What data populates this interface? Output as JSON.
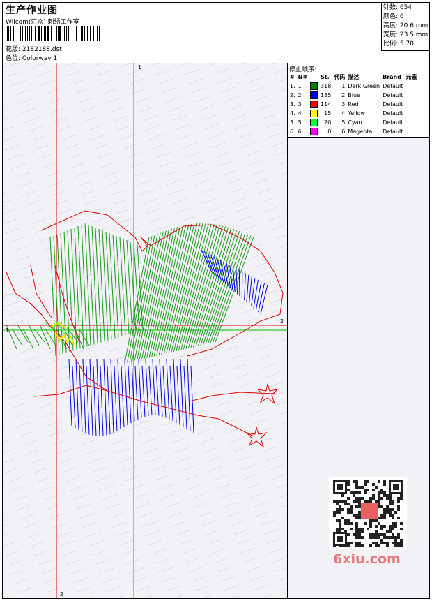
{
  "header": {
    "title": "生产作业图",
    "company": "Wilcom(汇众) 刺绣工作室",
    "design_label": "花版:",
    "design_value": "2182188.dst",
    "colorway_label": "色位:",
    "colorway_value": "Colorway 1"
  },
  "stats": {
    "stitches": "针数: 654",
    "colors": "颜色: 6",
    "height": "高度: 20.6 mm",
    "width": "宽度: 23.5 mm",
    "scale": "比例: 5.70"
  },
  "stop_sequence": {
    "title": "停止顺序:",
    "headers": [
      "#",
      "N#",
      "St.",
      "代码",
      "描述",
      "Brand",
      "元素"
    ],
    "rows": [
      {
        "idx": "1.",
        "n": "1",
        "color": "#008000",
        "st": "318",
        "code": "1",
        "desc": "Dark Green",
        "brand": "Default"
      },
      {
        "idx": "2.",
        "n": "2",
        "color": "#0000ff",
        "st": "185",
        "code": "2",
        "desc": "Blue",
        "brand": "Default"
      },
      {
        "idx": "3.",
        "n": "3",
        "color": "#ff0000",
        "st": "114",
        "code": "3",
        "desc": "Red",
        "brand": "Default"
      },
      {
        "idx": "4.",
        "n": "4",
        "color": "#ffff00",
        "st": "15",
        "code": "4",
        "desc": "Yellow",
        "brand": "Default"
      },
      {
        "idx": "5.",
        "n": "5",
        "color": "#00ff40",
        "st": "20",
        "code": "5",
        "desc": "Cyan",
        "brand": "Default"
      },
      {
        "idx": "6.",
        "n": "6",
        "color": "#ff00ff",
        "st": "0",
        "code": "6",
        "desc": "Magenta",
        "brand": "Default"
      }
    ]
  },
  "axis_labels": {
    "top": "1",
    "right": "2",
    "left": "1",
    "bottom": "2"
  },
  "watermark": {
    "text": "6xiu.com",
    "seal": "以图绣图"
  }
}
